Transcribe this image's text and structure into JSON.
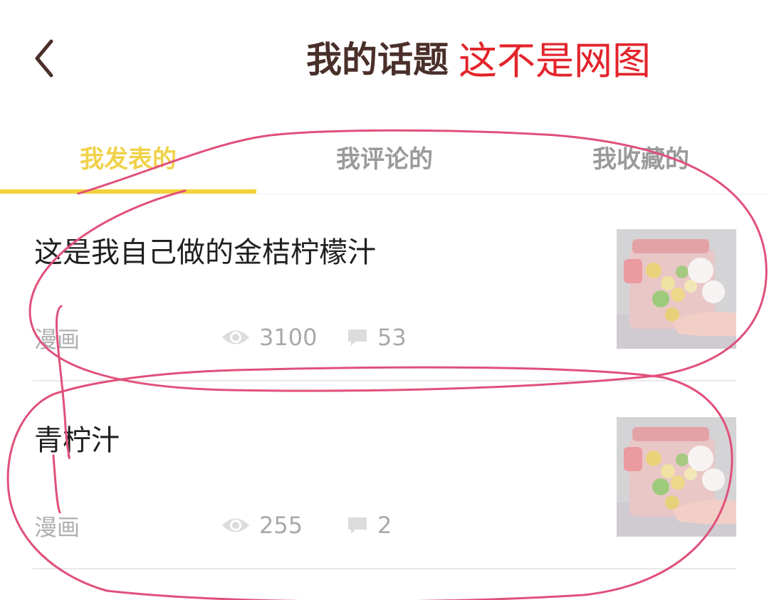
{
  "header": {
    "back_icon": "chevron-left-icon",
    "title": "我的话题",
    "title_extra": "这不是网图"
  },
  "tabs": [
    {
      "label": "我发表的",
      "active": true
    },
    {
      "label": "我评论的",
      "active": false
    },
    {
      "label": "我收藏的",
      "active": false
    }
  ],
  "colors": {
    "accent": "#f3d23c",
    "title_extra": "#e3242b",
    "annotation": "#e0507a"
  },
  "posts": [
    {
      "title": "这是我自己做的金桔柠檬汁",
      "tag": "漫画",
      "views": "3100",
      "comments": "53",
      "thumbnail": "lemon-juice-cup-photo"
    },
    {
      "title": "青柠汁",
      "tag": "漫画",
      "views": "255",
      "comments": "2",
      "thumbnail": "lemon-juice-cup-photo"
    }
  ]
}
